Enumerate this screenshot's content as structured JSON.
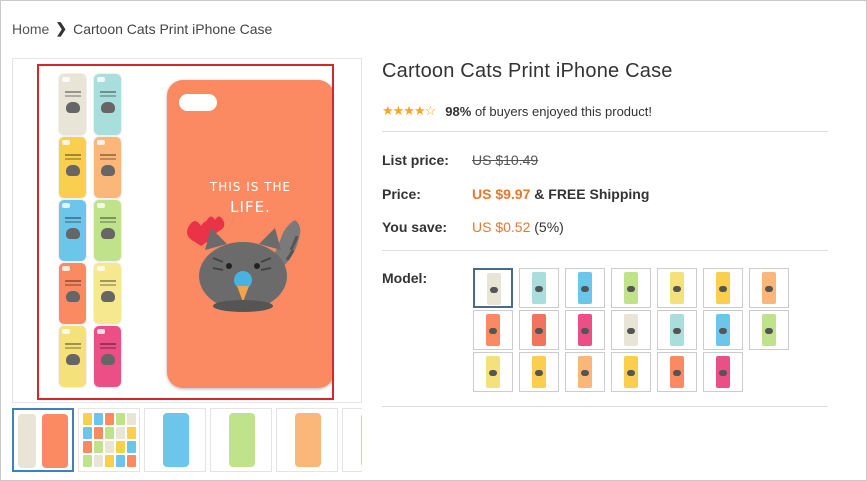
{
  "breadcrumb": {
    "home": "Home",
    "current": "Cartoon Cats Print iPhone Case"
  },
  "product": {
    "title": "Cartoon Cats Print iPhone Case",
    "rating": {
      "stars": 4.5,
      "percent": "98%",
      "text": "of buyers enjoyed this product!"
    },
    "list_price_label": "List price:",
    "list_price": "US $10.49",
    "price_label": "Price:",
    "price": "US $9.97",
    "price_suffix": "& FREE Shipping",
    "save_label": "You save:",
    "save_amount": "US $0.52",
    "save_percent": "(5%)",
    "model_label": "Model:"
  },
  "main_image": {
    "quote_line1": "THIS IS THE",
    "quote_line2": "LIFE."
  },
  "colors": {
    "accent_price": "#e8772e",
    "selection_border": "#d9262c",
    "star": "#f5a623"
  },
  "mini_cases": [
    "#e9e5d6",
    "#a8dfdc",
    "#f9cf4d",
    "#fbb77a",
    "#6cc6ec",
    "#bfe28a",
    "#fb8a63",
    "#f5e88e",
    "#f5e17a",
    "#ec4f86"
  ],
  "thumbnails": [
    {
      "name": "thumb-1",
      "colors": [
        "#e9e5d6",
        "#fb8a63"
      ]
    },
    {
      "name": "thumb-2",
      "colors": [
        "#f9cf4d",
        "#6cc6ec"
      ]
    },
    {
      "name": "thumb-3",
      "colors": [
        "#6cc6ec"
      ]
    },
    {
      "name": "thumb-4",
      "colors": [
        "#bfe28a"
      ]
    },
    {
      "name": "thumb-5",
      "colors": [
        "#fbb77a"
      ]
    },
    {
      "name": "thumb-6",
      "colors": [
        "#f9cf4d"
      ]
    }
  ],
  "models": [
    "#e9e5d6",
    "#a8dfdc",
    "#6cc6ec",
    "#bfe28a",
    "#f5e17a",
    "#f9cf4d",
    "#fbb77a",
    "#fb8a63",
    "#f0745e",
    "#ec4f86",
    "#e9e5d6",
    "#a8dfdc",
    "#6cc6ec",
    "#bfe28a",
    "#f5e17a",
    "#f9cf4d",
    "#fbb77a",
    "#f9cf4d",
    "#fb8a63",
    "#ec4f86"
  ]
}
